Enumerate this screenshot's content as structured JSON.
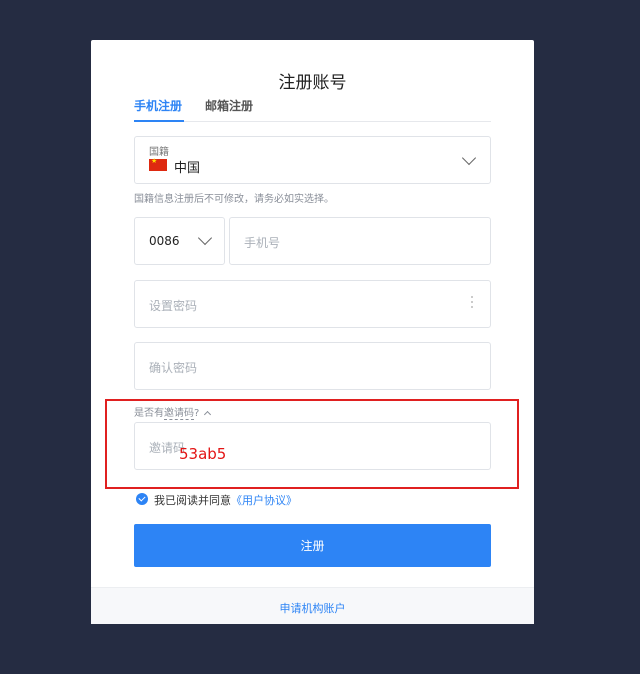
{
  "form": {
    "title": "注册账号",
    "tabs": [
      {
        "label": "手机注册"
      },
      {
        "label": "邮箱注册"
      }
    ],
    "nationality": {
      "label": "国籍",
      "value": "中国",
      "hint": "国籍信息注册后不可修改，请务必如实选择。"
    },
    "country_code": "0086",
    "phone_placeholder": "手机号",
    "password_placeholder": "设置密码",
    "confirm_placeholder": "确认密码",
    "invite": {
      "toggle_prefix": "是否有",
      "toggle_link": "邀请码",
      "toggle_suffix": "?",
      "placeholder": "邀请码",
      "annotation": "53ab5"
    },
    "agreement": {
      "text": "我已阅读并同意",
      "link": "《用户协议》"
    },
    "submit_label": "注册",
    "footer_link": "申请机构账户"
  },
  "colors": {
    "background": "#252c42",
    "accent": "#2d84f5",
    "highlight": "#e02020"
  }
}
